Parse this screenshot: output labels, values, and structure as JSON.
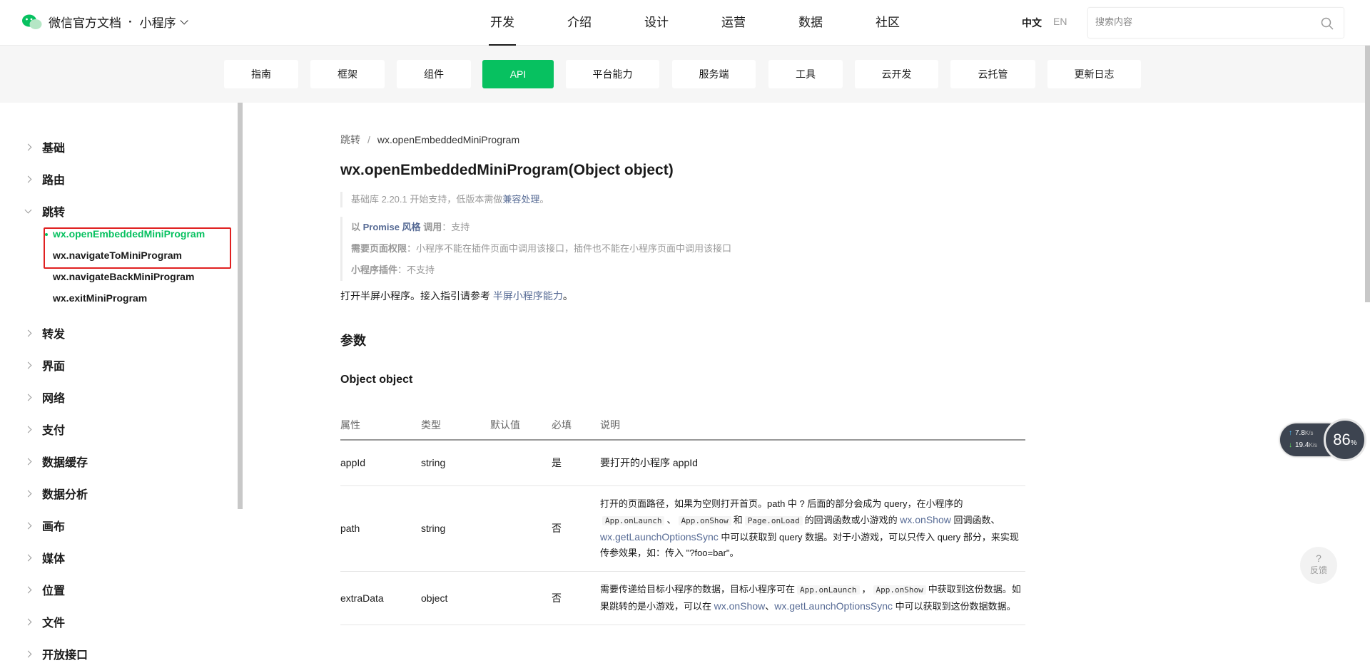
{
  "brand": {
    "title": "微信官方文档",
    "product": "小程序"
  },
  "mainnav": [
    "开发",
    "介绍",
    "设计",
    "运营",
    "数据",
    "社区"
  ],
  "lang": {
    "zh": "中文",
    "en": "EN"
  },
  "search": {
    "placeholder": "搜索内容"
  },
  "tabs": [
    "指南",
    "框架",
    "组件",
    "API",
    "平台能力",
    "服务端",
    "工具",
    "云开发",
    "云托管",
    "更新日志"
  ],
  "sidebar": {
    "groups": [
      "基础",
      "路由",
      "跳转",
      "转发",
      "界面",
      "网络",
      "支付",
      "数据缓存",
      "数据分析",
      "画布",
      "媒体",
      "位置",
      "文件",
      "开放接口"
    ],
    "sub": [
      "wx.openEmbeddedMiniProgram",
      "wx.navigateToMiniProgram",
      "wx.navigateBackMiniProgram",
      "wx.exitMiniProgram"
    ]
  },
  "breadcrumb": {
    "parent": "跳转",
    "sep": "/",
    "current": "wx.openEmbeddedMiniProgram"
  },
  "title": "wx.openEmbeddedMiniProgram(Object object)",
  "notes": {
    "lib": "基础库 2.20.1 开始支持，低版本需做",
    "lib_link": "兼容处理",
    "lib_end": "。",
    "promise_pre": "以",
    "promise_link": "Promise 风格",
    "promise_label": "调用",
    "promise_val": "：支持",
    "perm_label": "需要页面权限",
    "perm_val": "：小程序不能在插件页面中调用该接口，插件也不能在小程序页面中调用该接口",
    "plugin_label": "小程序插件",
    "plugin_val": "：不支持"
  },
  "desc": {
    "text": "打开半屏小程序。接入指引请参考 ",
    "link": "半屏小程序能力",
    "end": "。"
  },
  "section": {
    "params": "参数",
    "object": "Object object"
  },
  "table": {
    "headers": [
      "属性",
      "类型",
      "默认值",
      "必填",
      "说明"
    ],
    "rows": [
      {
        "name": "appId",
        "type": "string",
        "default": "",
        "required": "是",
        "desc": "要打开的小程序 appId"
      },
      {
        "name": "path",
        "type": "string",
        "default": "",
        "required": "否",
        "d1": "打开的页面路径，如果为空则打开首页。path 中 ? 后面的部分会成为 query，在小程序的",
        "c1": "App.onLaunch",
        "s1": "、",
        "c2": "App.onShow",
        "s2": "和",
        "c3": "Page.onLoad",
        "s3": "的回调函数或小游戏的",
        "l1": "wx.onShow",
        "s4": "回调函数、",
        "l2": "wx.getLaunchOptionsSync",
        "d2": "中可以获取到 query 数据。对于小游戏，可以只传入 query 部分，来实现传参效果，如：传入 \"?foo=bar\"。"
      },
      {
        "name": "extraData",
        "type": "object",
        "default": "",
        "required": "否",
        "d1": "需要传递给目标小程序的数据，目标小程序可在",
        "c1": "App.onLaunch",
        "s1": "，",
        "c2": "App.onShow",
        "s2": "中获取到这份数据。如果跳转的是小游戏，可以在",
        "l1": "wx.onShow",
        "s3": "、",
        "l2": "wx.getLaunchOptionsSync",
        "d2": "中可以获取到这份数据数据。"
      }
    ]
  },
  "speed": {
    "up": "7.8",
    "down": "19.4",
    "unit": "K/s",
    "percent": "86",
    "pct_sign": "%"
  },
  "feedback": {
    "q": "?",
    "label": "反馈"
  },
  "colors": {
    "accent": "#07c160",
    "link": "#576b95",
    "highlight_box": "#e02020"
  }
}
